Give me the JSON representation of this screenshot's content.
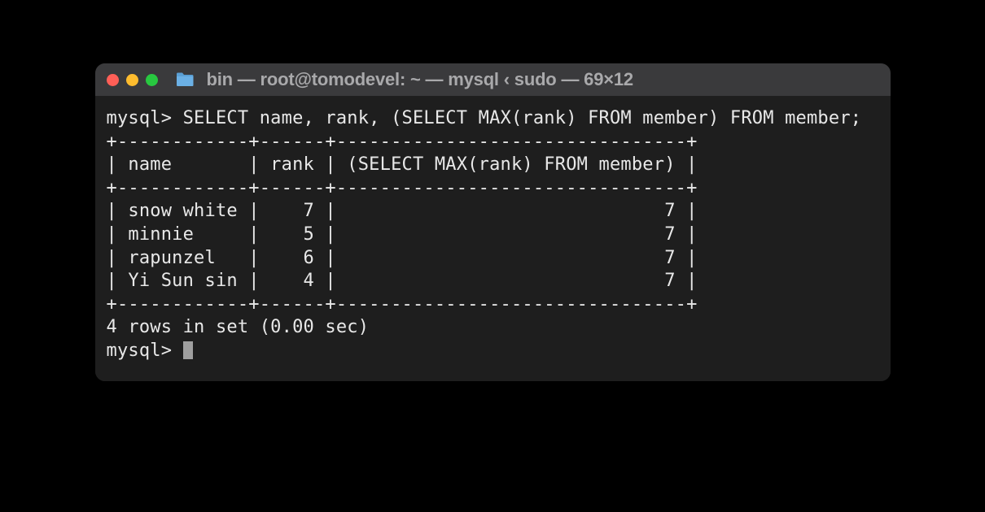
{
  "window": {
    "title": "bin — root@tomodevel: ~ — mysql ‹ sudo — 69×12"
  },
  "lines": {
    "l0": "mysql> SELECT name, rank, (SELECT MAX(rank) FROM member) FROM member;",
    "l1": "+------------+------+--------------------------------+",
    "l2": "| name       | rank | (SELECT MAX(rank) FROM member) |",
    "l3": "+------------+------+--------------------------------+",
    "l4": "| snow white |    7 |                              7 |",
    "l5": "| minnie     |    5 |                              7 |",
    "l6": "| rapunzel   |    6 |                              7 |",
    "l7": "| Yi Sun sin |    4 |                              7 |",
    "l8": "+------------+------+--------------------------------+",
    "l9": "4 rows in set (0.00 sec)",
    "l10": "",
    "l11": "mysql> "
  },
  "query": {
    "prompt": "mysql>",
    "sql": "SELECT name, rank, (SELECT MAX(rank) FROM member) FROM member;",
    "columns": [
      "name",
      "rank",
      "(SELECT MAX(rank) FROM member)"
    ],
    "rows": [
      {
        "name": "snow white",
        "rank": 7,
        "max_rank": 7
      },
      {
        "name": "minnie",
        "rank": 5,
        "max_rank": 7
      },
      {
        "name": "rapunzel",
        "rank": 6,
        "max_rank": 7
      },
      {
        "name": "Yi Sun sin",
        "rank": 4,
        "max_rank": 7
      }
    ],
    "footer": "4 rows in set (0.00 sec)"
  }
}
